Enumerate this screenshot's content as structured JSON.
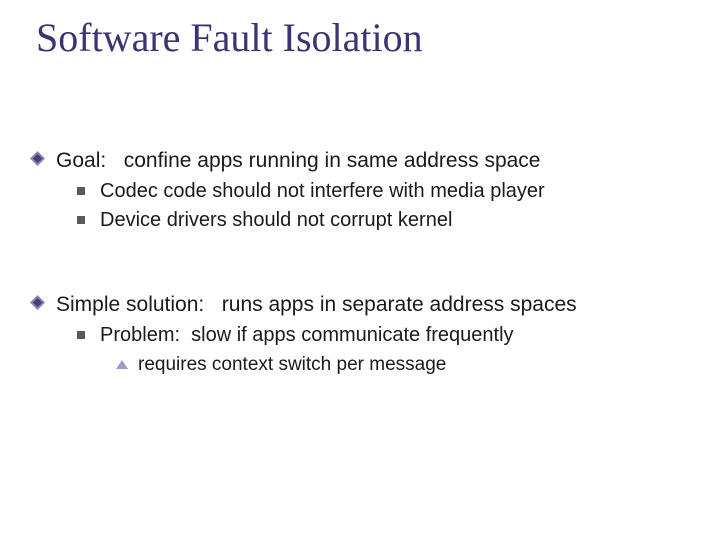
{
  "title": "Software Fault Isolation",
  "goal": {
    "label": "Goal:",
    "text": "confine apps running in same address space",
    "sub": [
      "Codec code should not interfere with media player",
      "Device drivers should not corrupt kernel"
    ]
  },
  "solution": {
    "label": "Simple solution:",
    "text": "runs apps in separate address spaces",
    "problem": {
      "label": "Problem:",
      "text": "slow if apps communicate frequently",
      "detail": "requires context switch per message"
    }
  }
}
